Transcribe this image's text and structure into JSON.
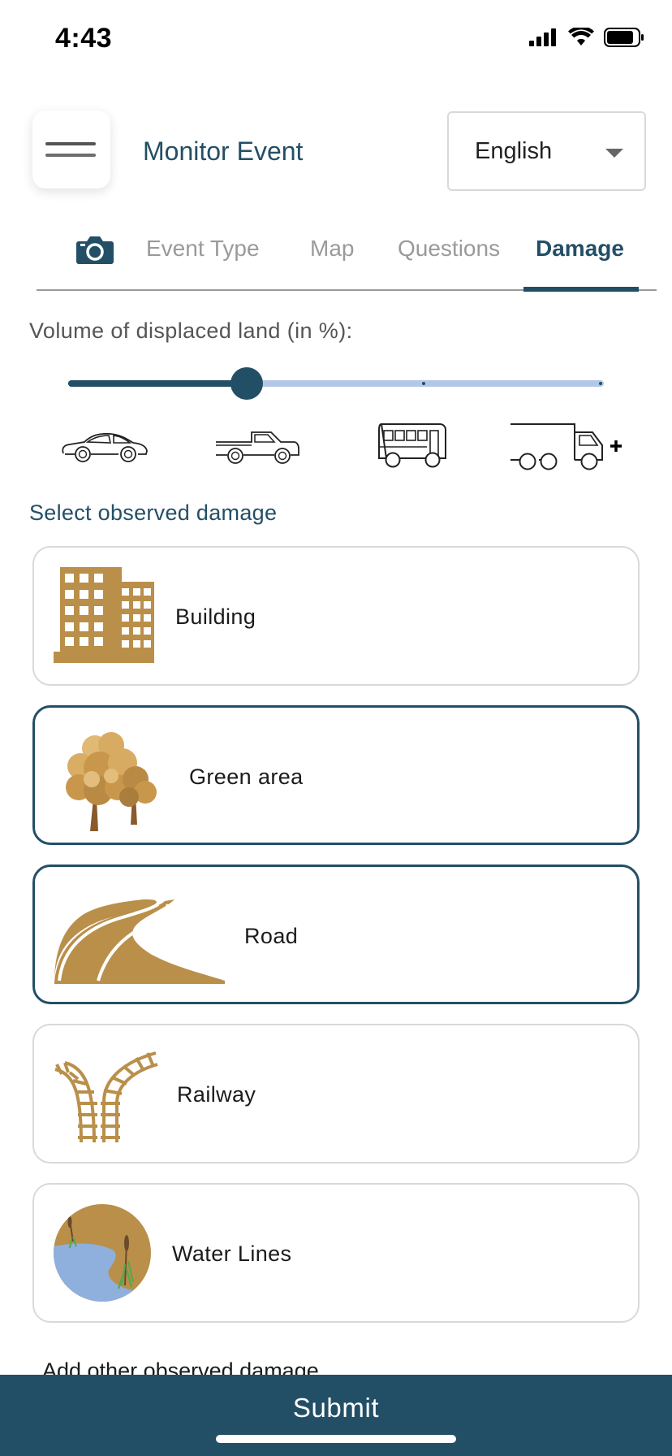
{
  "status_bar": {
    "time": "4:43"
  },
  "header": {
    "title": "Monitor Event",
    "language": "English"
  },
  "tabs": [
    {
      "label": "Event Type"
    },
    {
      "label": "Map"
    },
    {
      "label": "Questions"
    },
    {
      "label": "Damage"
    }
  ],
  "active_tab": "Damage",
  "slider": {
    "label": "Volume of displaced land (in %):",
    "value_fraction": 0.33,
    "steps": [
      "car",
      "pickup-truck",
      "bus",
      "truck-plus"
    ]
  },
  "damage": {
    "title": "Select observed damage",
    "items": [
      {
        "label": "Building",
        "selected": false
      },
      {
        "label": "Green area",
        "selected": true
      },
      {
        "label": "Road",
        "selected": true
      },
      {
        "label": "Railway",
        "selected": false
      },
      {
        "label": "Water Lines",
        "selected": false
      }
    ],
    "add_other": "Add other observed damage"
  },
  "submit": {
    "label": "Submit"
  },
  "colors": {
    "primary": "#234f66",
    "icon_tan": "#b98f4a",
    "slider_track": "#b3c7e6",
    "tab_inactive": "#9a9a9a",
    "water": "#8fb0dc"
  }
}
